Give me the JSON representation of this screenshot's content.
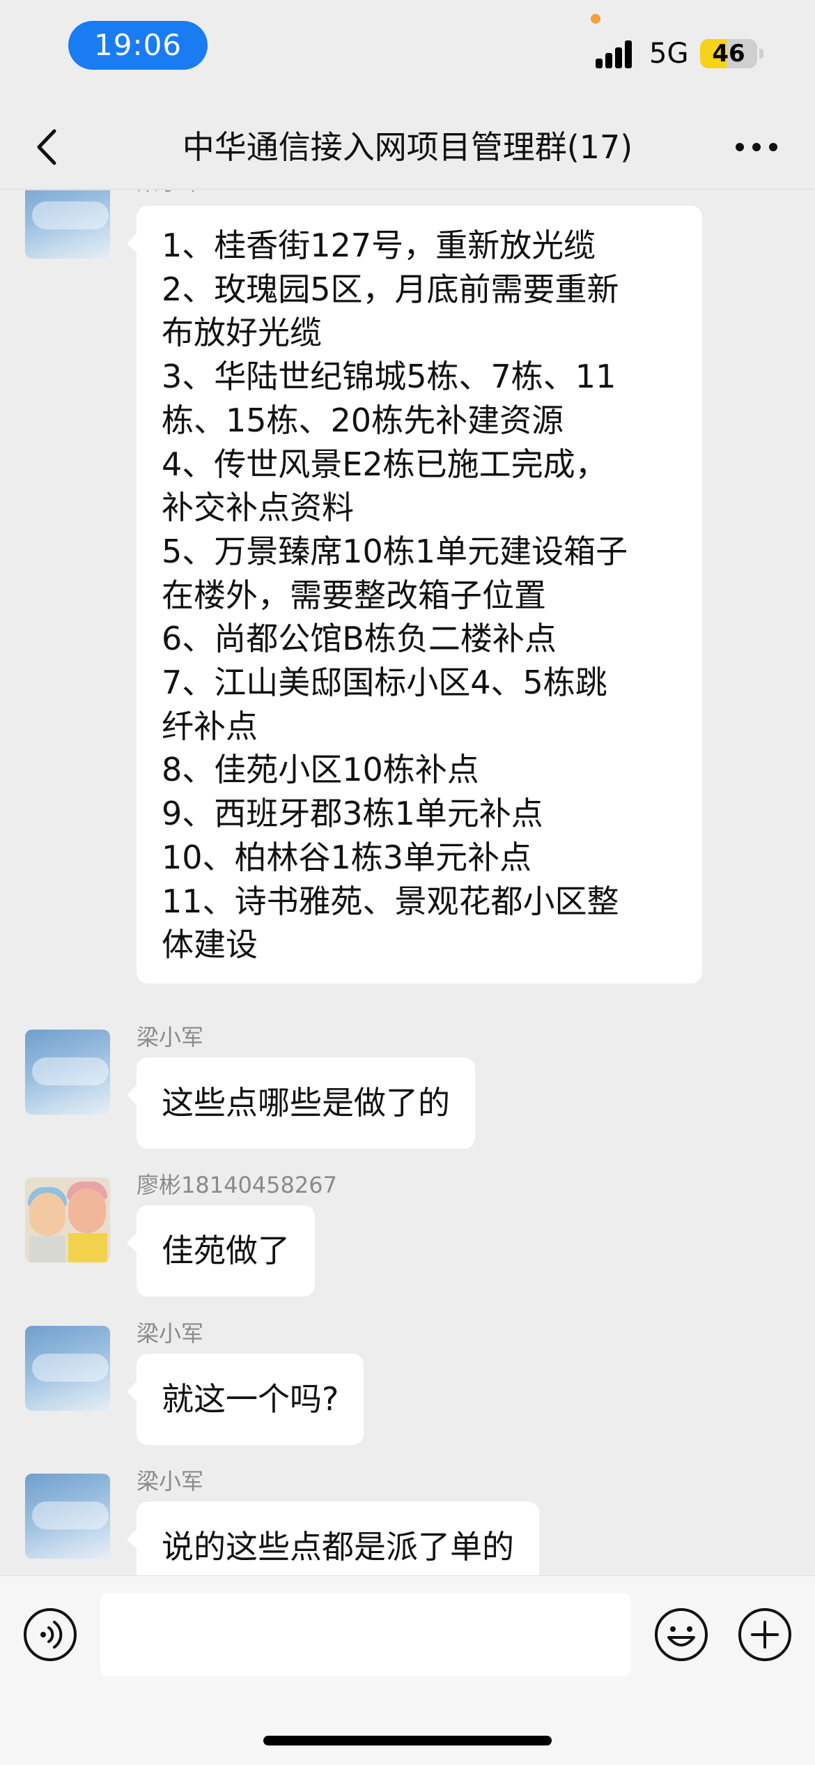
{
  "status_bar": {
    "time": "19:06",
    "network": "5G",
    "battery": "46",
    "battery_level": 0.46
  },
  "nav": {
    "title": "中华通信接入网项目管理群(17)",
    "back_icon": "chevron-left-icon",
    "more_icon": "more-dots-icon"
  },
  "messages": [
    {
      "sender": "梁小军",
      "lines": [
        "1、桂香街127号，重新放光缆",
        "2、玫瑰园5区，月底前需要重新",
        "布放好光缆",
        "3、华陆世纪锦城5栋、7栋、11",
        "栋、15栋、20栋先补建资源",
        "4、传世风景E2栋已施工完成，",
        "补交补点资料",
        "5、万景臻席10栋1单元建设箱子",
        "在楼外，需要整改箱子位置",
        "6、尚都公馆B栋负二楼补点",
        "7、江山美邸国标小区4、5栋跳",
        "纤补点",
        "8、佳苑小区10栋补点",
        "9、西班牙郡3栋1单元补点",
        "10、柏林谷1栋3单元补点",
        "11、诗书雅苑、景观花都小区整",
        "体建设"
      ]
    },
    {
      "sender": "梁小军",
      "text": "这些点哪些是做了的"
    },
    {
      "sender": "廖彬18140458267",
      "text": "佳苑做了"
    },
    {
      "sender": "梁小军",
      "text": "就这一个吗?"
    },
    {
      "sender": "梁小军",
      "text": "说的这些点都是派了单的"
    }
  ],
  "input_bar": {
    "voice_icon": "voice-icon",
    "input_value": "",
    "emoji_icon": "emoji-icon",
    "plus_icon": "plus-icon"
  },
  "colors": {
    "background": "#ededed",
    "bubble": "#ffffff",
    "time_pill": "#1a7cf3",
    "battery": "#f7d21b"
  }
}
